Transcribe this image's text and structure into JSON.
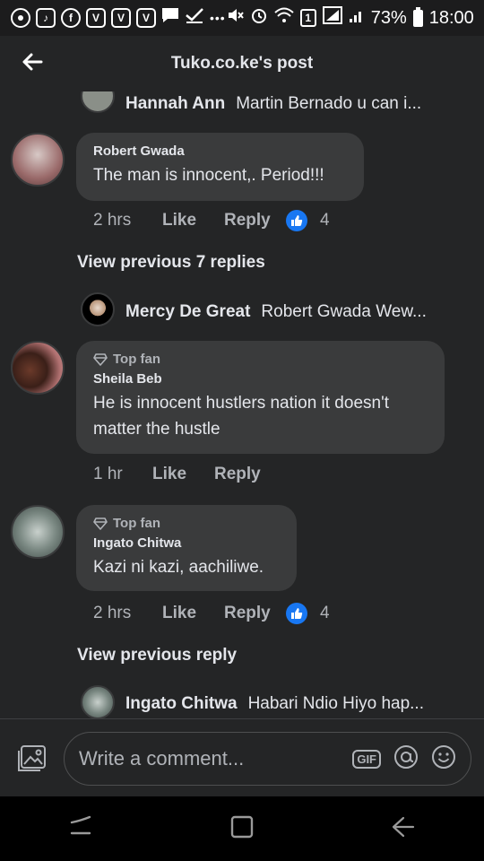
{
  "status_bar": {
    "battery": "73%",
    "time": "18:00",
    "icons": [
      "chrome-icon",
      "tiktok-icon",
      "facebook-icon",
      "v-icon",
      "v-icon",
      "v-icon",
      "chat-icon",
      "check-icon",
      "more-icon",
      "mute-icon",
      "alarm-icon",
      "wifi-icon",
      "sim-icon",
      "signal-icon",
      "signal2-icon",
      "battery-icon"
    ],
    "sim_label": "1",
    "more_label": "•••"
  },
  "header": {
    "title": "Tuko.co.ke's post"
  },
  "thread": {
    "top_reply_preview": {
      "name": "Hannah Ann",
      "text": "Martin Bernado  u can i..."
    },
    "comments": [
      {
        "author": "Robert Gwada",
        "text": "The man is innocent,. Period!!!",
        "time": "2 hrs",
        "like_label": "Like",
        "reply_label": "Reply",
        "reaction_count": "4",
        "view_prev_label": "View previous 7 replies",
        "reply_preview": {
          "name": "Mercy De Great",
          "text": "Robert Gwada Wew..."
        }
      },
      {
        "badge": "Top fan",
        "author": "Sheila Beb",
        "text": "He is innocent hustlers nation it doesn't matter the hustle",
        "time": "1 hr",
        "like_label": "Like",
        "reply_label": "Reply"
      },
      {
        "badge": "Top fan",
        "author": "Ingato Chitwa",
        "text": "Kazi ni kazi, aachiliwe.",
        "time": "2 hrs",
        "like_label": "Like",
        "reply_label": "Reply",
        "reaction_count": "4",
        "view_prev_label": "View previous reply",
        "reply_preview": {
          "name": "Ingato Chitwa",
          "text": "Habari Ndio Hiyo hap..."
        }
      }
    ]
  },
  "composer": {
    "placeholder": "Write a comment...",
    "gif_label": "GIF"
  },
  "colors": {
    "background": "#242526",
    "bubble": "#3a3b3c",
    "like_blue": "#1877f2",
    "secondary_text": "#b0b3b8"
  }
}
